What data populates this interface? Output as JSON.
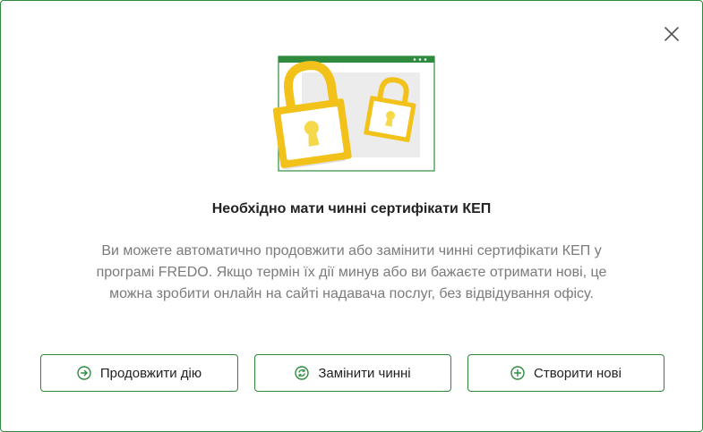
{
  "dialog": {
    "title": "Необхідно мати чинні сертифікати КЕП",
    "body_lines": [
      "Ви можете автоматично продовжити або замінити чинні сертифікати КЕП у",
      "програмі FREDO. Якщо термін їх дії минув або ви бажаєте отримати нові, це",
      "можна зробити онлайн на сайті надавача послуг, без відвідування офісу."
    ],
    "close_icon": "close-icon",
    "illustration_icon": "padlocks-illustration"
  },
  "buttons": [
    {
      "label": "Продовжити дію",
      "icon": "arrow-right-circle-icon"
    },
    {
      "label": "Замінити чинні",
      "icon": "refresh-circle-icon"
    },
    {
      "label": "Створити нові",
      "icon": "plus-circle-icon"
    }
  ],
  "colors": {
    "accent": "#2e8b3e",
    "lock_yellow": "#f2c21b",
    "lock_keyhole": "#f5d94a",
    "text_primary": "#222222",
    "text_secondary": "#7b7b7b"
  }
}
